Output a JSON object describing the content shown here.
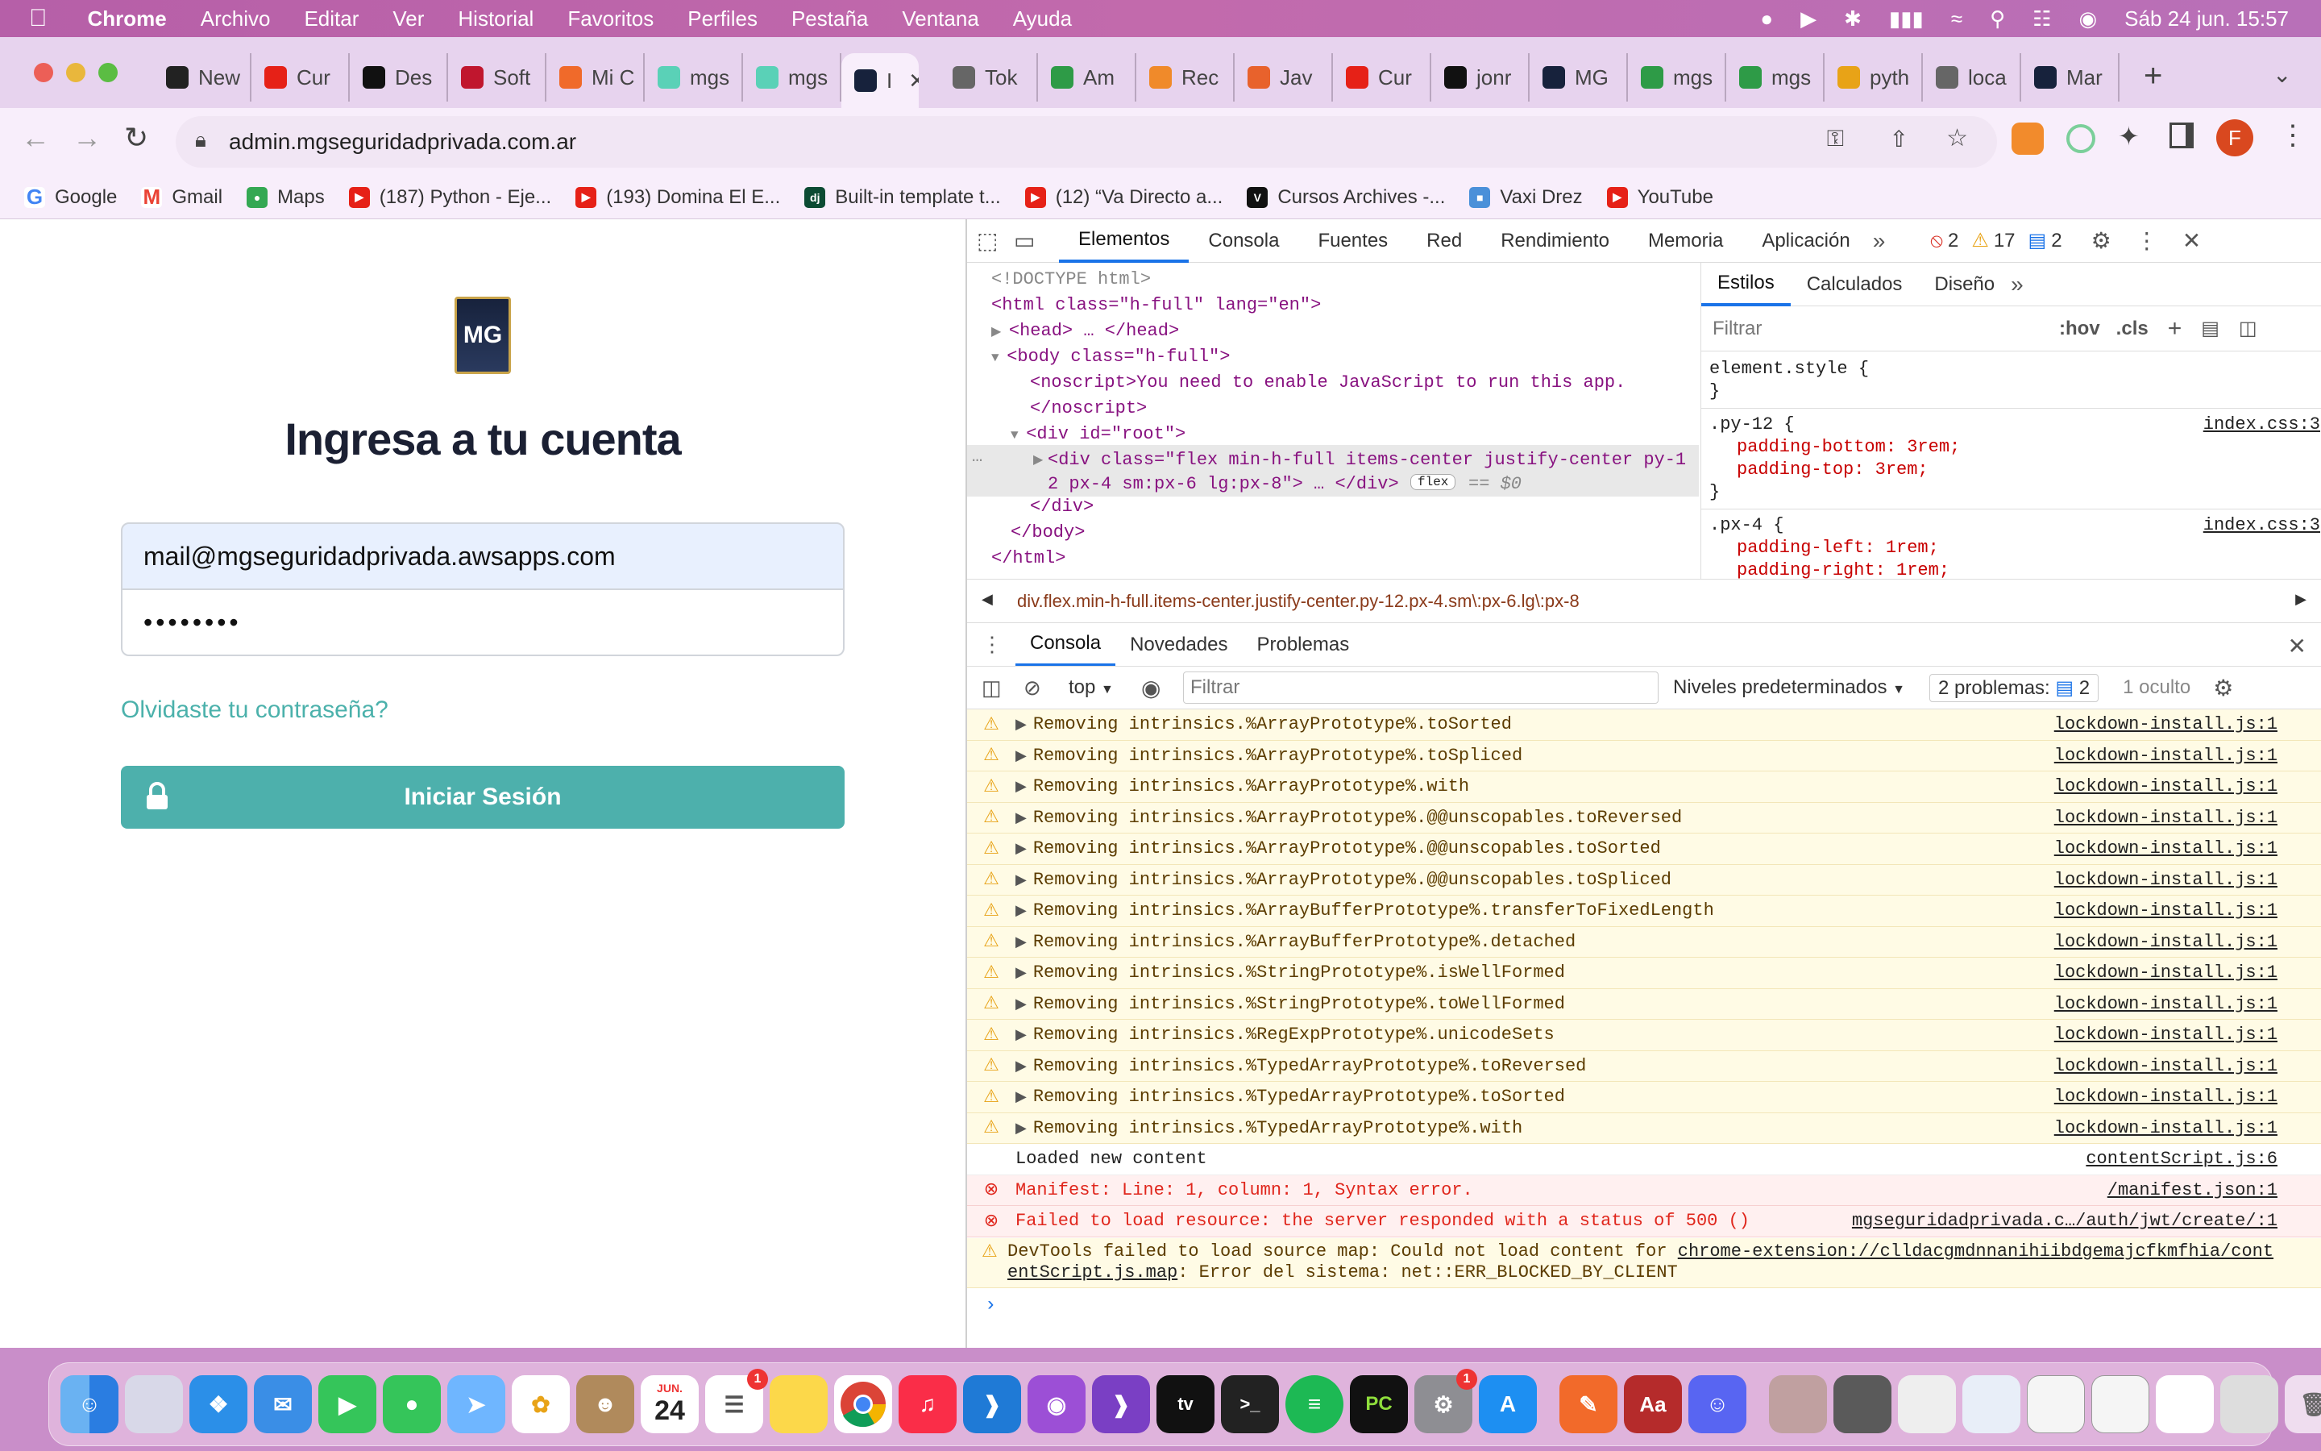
{
  "menubar": {
    "app": "Chrome",
    "items": [
      "Archivo",
      "Editar",
      "Ver",
      "Historial",
      "Favoritos",
      "Perfiles",
      "Pestaña",
      "Ventana",
      "Ayuda"
    ],
    "clock": "Sáb 24 jun.  15:57"
  },
  "tabs": [
    "New",
    "Cur",
    "Des",
    "Soft",
    "Mi C",
    "mgs",
    "mgs",
    "I",
    "Tok",
    "Am",
    "Rec",
    "Jav",
    "Cur",
    "jonr",
    "MG",
    "mgs",
    "mgs",
    "pyth",
    "loca",
    "Mar"
  ],
  "address": {
    "url": "admin.mgseguridadprivada.com.ar"
  },
  "profile_initial": "F",
  "bookmarks": [
    "Google",
    "Gmail",
    "Maps",
    "(187) Python - Eje...",
    "(193) Domina El E...",
    "Built-in template t...",
    "(12) “Va Directo a...",
    "Cursos Archives -...",
    "Vaxi Drez",
    "YouTube"
  ],
  "login": {
    "logo_text": "MG",
    "title": "Ingresa a tu cuenta",
    "email": "mail@mgseguridadprivada.awsapps.com",
    "password": "••••••••",
    "forgot": "Olvidaste tu contraseña?",
    "submit": "Iniciar Sesión"
  },
  "devtools": {
    "tabs": [
      "Elementos",
      "Consola",
      "Fuentes",
      "Red",
      "Rendimiento",
      "Memoria",
      "Aplicación"
    ],
    "badges": {
      "errors": "2",
      "warnings": "17",
      "messages": "2"
    },
    "dom": [
      "<!DOCTYPE html>",
      "<html class=\"h-full\" lang=\"en\">",
      "<head> … </head>",
      "<body class=\"h-full\">",
      "<noscript>You need to enable JavaScript to run this app.",
      "</noscript>",
      "<div id=\"root\">",
      "<div class=\"flex min-h-full items-center justify-center py-1",
      "2 px-4 sm:px-6 lg:px-8\"> … </div>",
      "flex",
      "== $0",
      "</div>",
      "</body>",
      "</html>"
    ],
    "styles_tabs": [
      "Estilos",
      "Calculados",
      "Diseño"
    ],
    "styles_filter": "Filtrar",
    "styles_hov": ":hov",
    "styles_cls": ".cls",
    "styles": [
      "element.style {",
      "}",
      ".py-12 {",
      "padding-bottom: 3rem;",
      "padding-top: 3rem;",
      "}",
      ".px-4 {",
      "padding-left: 1rem;",
      "padding-right: 1rem;",
      "}"
    ],
    "styles_src": "index.css:3",
    "breadcrumb": "div.flex.min-h-full.items-center.justify-center.py-12.px-4.sm\\:px-6.lg\\:px-8",
    "drawer_tabs": [
      "Consola",
      "Novedades",
      "Problemas"
    ],
    "console_toolbar": {
      "context": "top",
      "filter": "Filtrar",
      "levels": "Niveles predeterminados",
      "problems": "2 problemas:",
      "problems_count": "2",
      "hidden": "1 oculto"
    },
    "console": [
      {
        "t": "warn",
        "m": "Removing intrinsics.%ArrayPrototype%.toSorted",
        "s": "lockdown-install.js:1"
      },
      {
        "t": "warn",
        "m": "Removing intrinsics.%ArrayPrototype%.toSpliced",
        "s": "lockdown-install.js:1"
      },
      {
        "t": "warn",
        "m": "Removing intrinsics.%ArrayPrototype%.with",
        "s": "lockdown-install.js:1"
      },
      {
        "t": "warn",
        "m": "Removing intrinsics.%ArrayPrototype%.@@unscopables.toReversed",
        "s": "lockdown-install.js:1"
      },
      {
        "t": "warn",
        "m": "Removing intrinsics.%ArrayPrototype%.@@unscopables.toSorted",
        "s": "lockdown-install.js:1"
      },
      {
        "t": "warn",
        "m": "Removing intrinsics.%ArrayPrototype%.@@unscopables.toSpliced",
        "s": "lockdown-install.js:1"
      },
      {
        "t": "warn",
        "m": "Removing intrinsics.%ArrayBufferPrototype%.transferToFixedLength",
        "s": "lockdown-install.js:1"
      },
      {
        "t": "warn",
        "m": "Removing intrinsics.%ArrayBufferPrototype%.detached",
        "s": "lockdown-install.js:1"
      },
      {
        "t": "warn",
        "m": "Removing intrinsics.%StringPrototype%.isWellFormed",
        "s": "lockdown-install.js:1"
      },
      {
        "t": "warn",
        "m": "Removing intrinsics.%StringPrototype%.toWellFormed",
        "s": "lockdown-install.js:1"
      },
      {
        "t": "warn",
        "m": "Removing intrinsics.%RegExpPrototype%.unicodeSets",
        "s": "lockdown-install.js:1"
      },
      {
        "t": "warn",
        "m": "Removing intrinsics.%TypedArrayPrototype%.toReversed",
        "s": "lockdown-install.js:1"
      },
      {
        "t": "warn",
        "m": "Removing intrinsics.%TypedArrayPrototype%.toSorted",
        "s": "lockdown-install.js:1"
      },
      {
        "t": "warn",
        "m": "Removing intrinsics.%TypedArrayPrototype%.with",
        "s": "lockdown-install.js:1"
      },
      {
        "t": "info",
        "m": "Loaded new content",
        "s": "contentScript.js:6"
      },
      {
        "t": "err",
        "m": "Manifest: Line: 1, column: 1, Syntax error.",
        "s": "/manifest.json:1"
      },
      {
        "t": "err",
        "m": "Failed to load resource: the server responded with a status of 500 ()",
        "s": "mgseguridadprivada.c…/auth/jwt/create/:1"
      }
    ],
    "devtools_warning": {
      "line1": "DevTools failed to load source map: Could not load content for ",
      "link1": "chrome-extension://clldacgmdnnanihiibdgemajcfkmfhia/cont",
      "link2": "entScript.js.map",
      "line2": ": Error del sistema: net::ERR_BLOCKED_BY_CLIENT"
    }
  },
  "dock": {
    "calendar_month": "JUN.",
    "calendar_day": "24",
    "badge": "1"
  }
}
